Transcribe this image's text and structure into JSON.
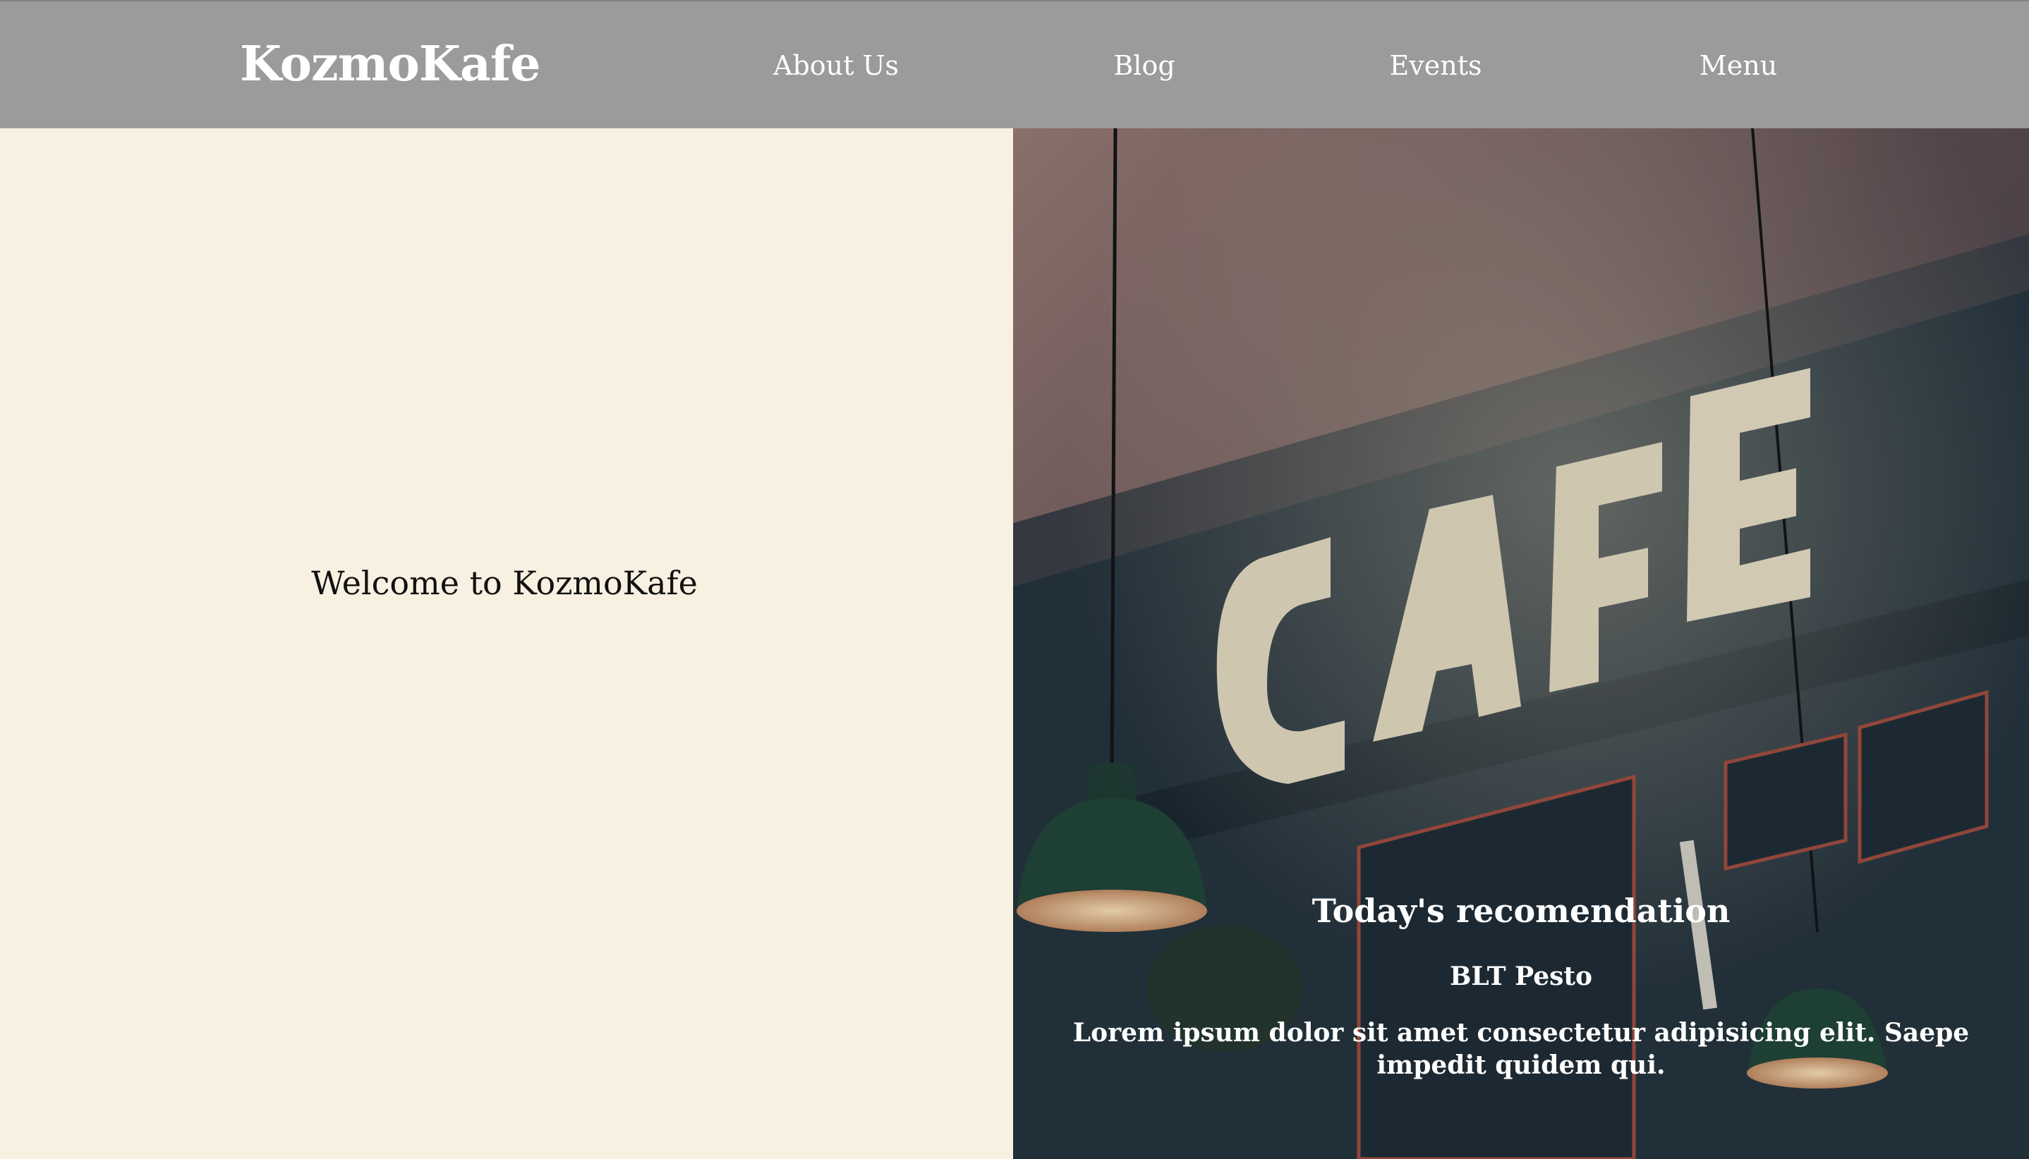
{
  "header": {
    "brand": "KozmoKafe",
    "nav": [
      "About Us",
      "Blog",
      "Events",
      "Menu"
    ]
  },
  "main": {
    "welcome": "Welcome to KozmoKafe"
  },
  "hero": {
    "sign_text": "CAFE",
    "recommendation_title": "Today's recomendation",
    "dish_name": "BLT Pesto",
    "dish_description": "Lorem ipsum dolor sit amet consectetur adipisicing elit. Saepe impedit quidem qui."
  },
  "colors": {
    "navbar": "#9b9b9b",
    "left_background": "#f8f0e1",
    "hero_dark": "#1f2c36",
    "text_light": "#ffffff"
  }
}
